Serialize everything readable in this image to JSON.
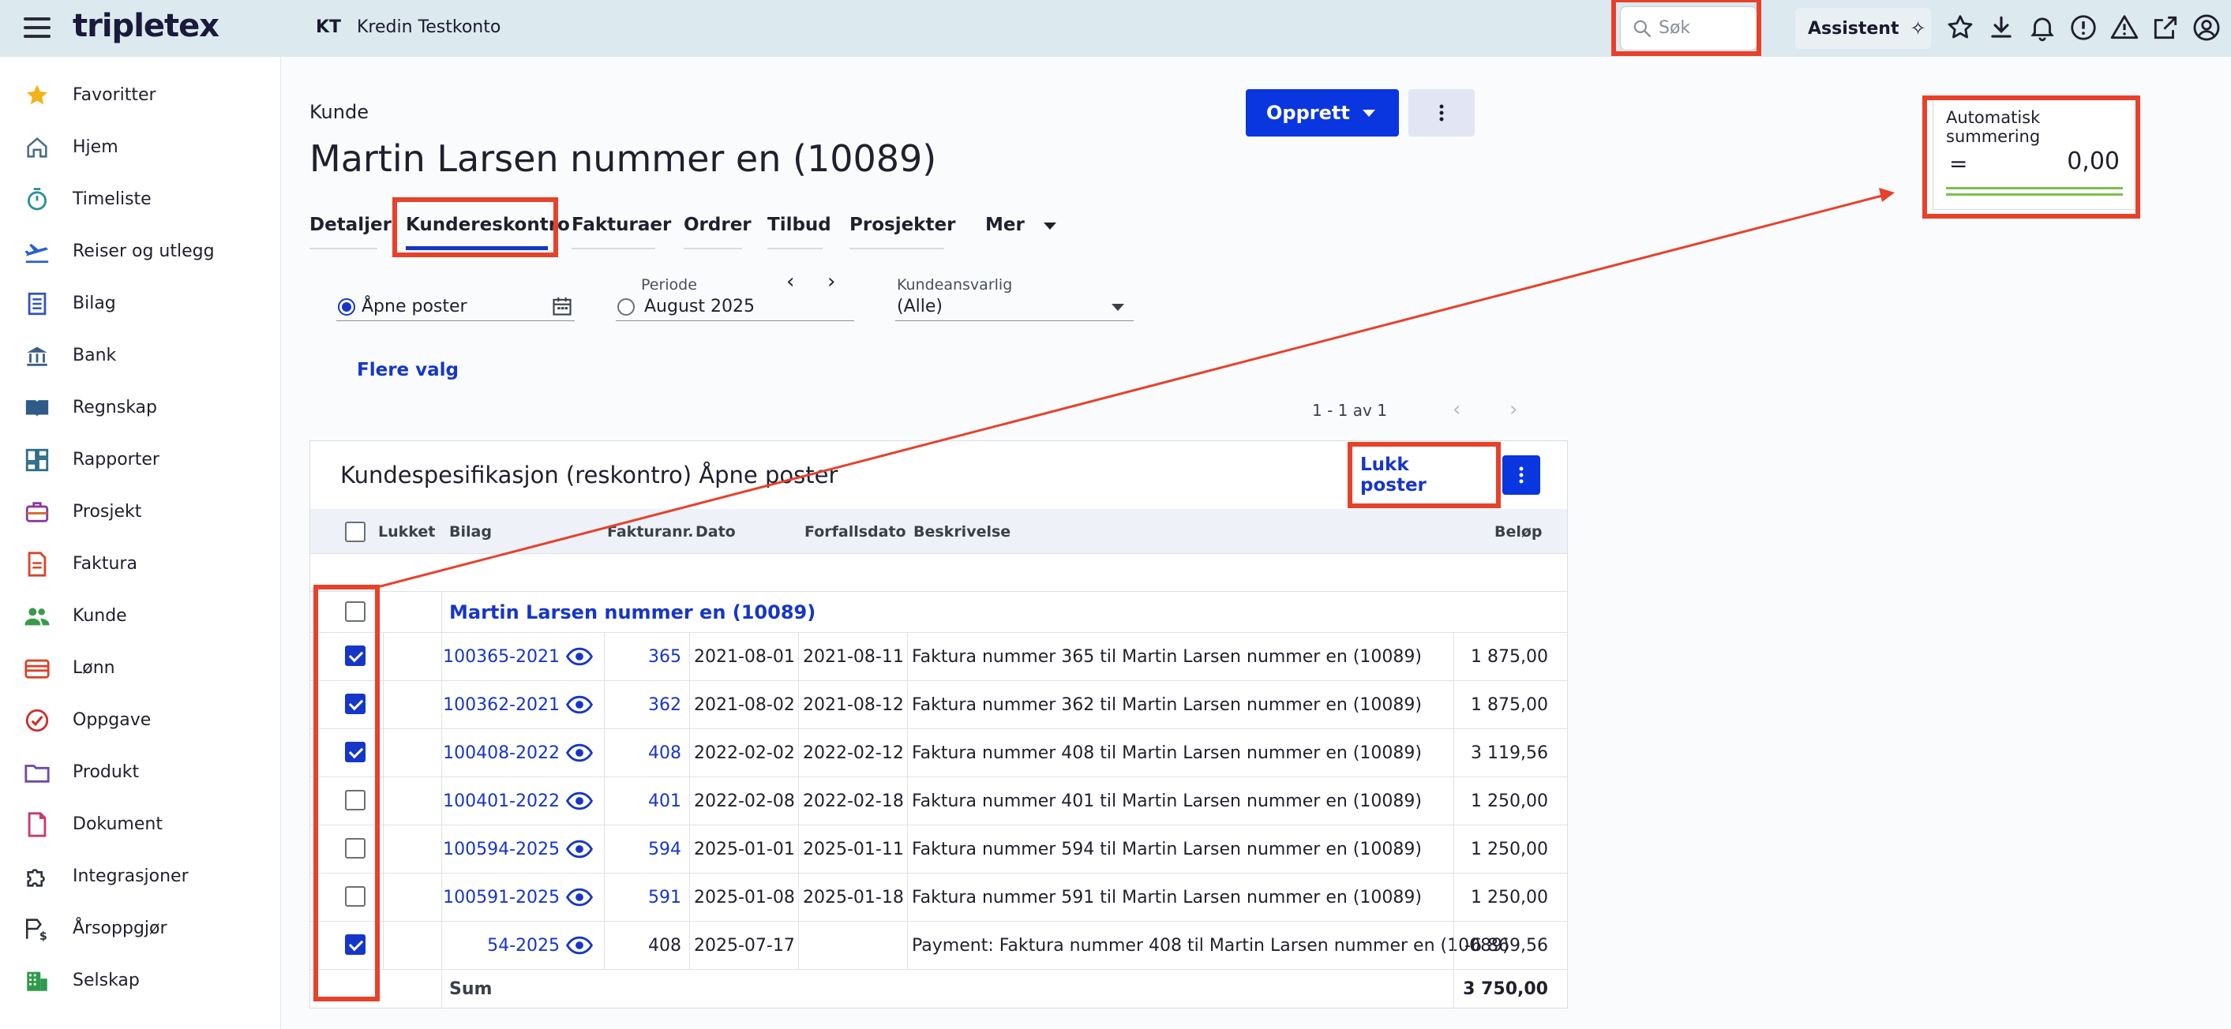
{
  "topbar": {
    "logo": "tripletex",
    "company_badge": "KT",
    "company_name": "Kredin Testkonto",
    "search_placeholder": "Søk",
    "assistant_label": "Assistent",
    "icons": [
      "star-icon",
      "download-icon",
      "bell-icon",
      "info-circle-icon",
      "warning-icon",
      "external-link-icon",
      "user-icon"
    ]
  },
  "sidebar": {
    "items": [
      {
        "label": "Favoritter",
        "icon": "star-icon"
      },
      {
        "label": "Hjem",
        "icon": "home-icon"
      },
      {
        "label": "Timeliste",
        "icon": "stopwatch-icon"
      },
      {
        "label": "Reiser og utlegg",
        "icon": "plane-icon"
      },
      {
        "label": "Bilag",
        "icon": "voucher-icon"
      },
      {
        "label": "Bank",
        "icon": "bank-icon"
      },
      {
        "label": "Regnskap",
        "icon": "book-icon"
      },
      {
        "label": "Rapporter",
        "icon": "dashboard-icon"
      },
      {
        "label": "Prosjekt",
        "icon": "briefcase-icon"
      },
      {
        "label": "Faktura",
        "icon": "invoice-icon"
      },
      {
        "label": "Kunde",
        "icon": "people-icon"
      },
      {
        "label": "Lønn",
        "icon": "wallet-icon"
      },
      {
        "label": "Oppgave",
        "icon": "check-circle-icon"
      },
      {
        "label": "Produkt",
        "icon": "folder-icon"
      },
      {
        "label": "Dokument",
        "icon": "document-icon"
      },
      {
        "label": "Integrasjoner",
        "icon": "puzzle-icon"
      },
      {
        "label": "Årsoppgjør",
        "icon": "year-end-icon"
      },
      {
        "label": "Selskap",
        "icon": "building-icon"
      }
    ]
  },
  "header": {
    "breadcrumb": "Kunde",
    "title": "Martin Larsen nummer en (10089)",
    "create_button": "Opprett"
  },
  "tabs": [
    {
      "label": "Detaljer",
      "active": false
    },
    {
      "label": "Kundereskontro",
      "active": true
    },
    {
      "label": "Fakturaer",
      "active": false
    },
    {
      "label": "Ordrer",
      "active": false
    },
    {
      "label": "Tilbud",
      "active": false
    },
    {
      "label": "Prosjekter",
      "active": false
    },
    {
      "label": "Mer",
      "active": false
    }
  ],
  "filters": {
    "open_items_label": "Åpne poster",
    "period_label": "Periode",
    "period_value": "August 2025",
    "responsible_label": "Kundeansvarlig",
    "responsible_value": "(Alle)",
    "more_options": "Flere valg"
  },
  "pager": {
    "text": "1 - 1 av 1"
  },
  "auto_sum": {
    "title": "Automatisk summering",
    "eq": "=",
    "value": "0,00"
  },
  "table": {
    "title": "Kundespesifikasjon (reskontro) Åpne poster",
    "close_button": "Lukk poster",
    "columns": [
      "Lukket",
      "Bilag",
      "Fakturanr.",
      "Dato",
      "Forfallsdato",
      "Beskrivelse",
      "Beløp"
    ],
    "group": "Martin Larsen nummer en (10089)",
    "rows": [
      {
        "checked": true,
        "bilag": "100365-2021",
        "faktnr": "365",
        "dato": "2021-08-01",
        "forfall": "2021-08-11",
        "beskr": "Faktura nummer 365 til Martin Larsen nummer en (10089)",
        "belop": "1 875,00",
        "faktlink": true
      },
      {
        "checked": true,
        "bilag": "100362-2021",
        "faktnr": "362",
        "dato": "2021-08-02",
        "forfall": "2021-08-12",
        "beskr": "Faktura nummer 362 til Martin Larsen nummer en (10089)",
        "belop": "1 875,00",
        "faktlink": true
      },
      {
        "checked": true,
        "bilag": "100408-2022",
        "faktnr": "408",
        "dato": "2022-02-02",
        "forfall": "2022-02-12",
        "beskr": "Faktura nummer 408 til Martin Larsen nummer en (10089)",
        "belop": "3 119,56",
        "faktlink": true
      },
      {
        "checked": false,
        "bilag": "100401-2022",
        "faktnr": "401",
        "dato": "2022-02-08",
        "forfall": "2022-02-18",
        "beskr": "Faktura nummer 401 til Martin Larsen nummer en (10089)",
        "belop": "1 250,00",
        "faktlink": true
      },
      {
        "checked": false,
        "bilag": "100594-2025",
        "faktnr": "594",
        "dato": "2025-01-01",
        "forfall": "2025-01-11",
        "beskr": "Faktura nummer 594 til Martin Larsen nummer en (10089)",
        "belop": "1 250,00",
        "faktlink": true
      },
      {
        "checked": false,
        "bilag": "100591-2025",
        "faktnr": "591",
        "dato": "2025-01-08",
        "forfall": "2025-01-18",
        "beskr": "Faktura nummer 591 til Martin Larsen nummer en (10089)",
        "belop": "1 250,00",
        "faktlink": true
      },
      {
        "checked": true,
        "bilag": "54-2025",
        "faktnr": "408",
        "dato": "2025-07-17",
        "forfall": "",
        "beskr": "Payment: Faktura nummer 408 til Martin Larsen nummer en (10089)",
        "belop": "-6 869,56",
        "faktlink": false
      }
    ],
    "sum_label": "Sum",
    "sum_value": "3 750,00"
  },
  "colors": {
    "primary": "#0a36e0",
    "link": "#1636c8",
    "topbar_bg": "#dce9ef",
    "annotation": "#e7412b",
    "sum_underline": "#7cc04a"
  }
}
